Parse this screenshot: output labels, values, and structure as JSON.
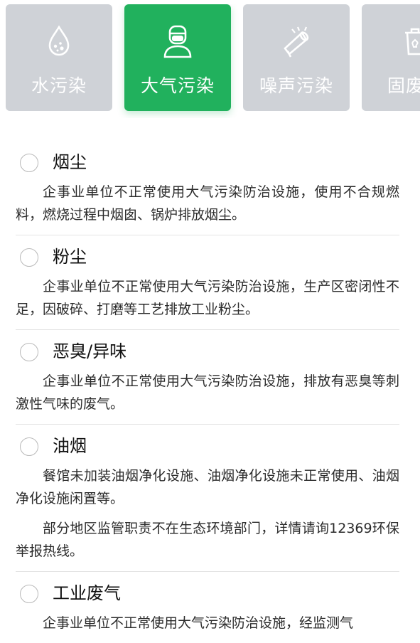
{
  "tabs": [
    {
      "label": "水污染",
      "icon": "water-drop-icon",
      "active": false
    },
    {
      "label": "大气污染",
      "icon": "masked-person-icon",
      "active": true
    },
    {
      "label": "噪声污染",
      "icon": "loudspeaker-icon",
      "active": false
    },
    {
      "label": "固废污",
      "icon": "trash-bin-icon",
      "active": false
    }
  ],
  "options": [
    {
      "title": "烟尘",
      "descriptions": [
        "企事业单位不正常使用大气污染防治设施，使用不合规燃料，燃烧过程中烟囱、锅炉排放烟尘。"
      ]
    },
    {
      "title": "粉尘",
      "descriptions": [
        "企事业单位不正常使用大气污染防治设施，生产区密闭性不足，因破碎、打磨等工艺排放工业粉尘。"
      ]
    },
    {
      "title": "恶臭/异味",
      "descriptions": [
        "企事业单位不正常使用大气污染防治设施，排放有恶臭等刺激性气味的废气。"
      ]
    },
    {
      "title": "油烟",
      "descriptions": [
        "餐馆未加装油烟净化设施、油烟净化设施未正常使用、油烟净化设施闲置等。",
        "部分地区监管职责不在生态环境部门，详情请询12369环保举报热线。"
      ]
    },
    {
      "title": "工业废气",
      "descriptions": [
        "企事业单位不正常使用大气污染防治设施，经监测气"
      ]
    }
  ],
  "colors": {
    "active_tab": "#21b15d",
    "inactive_tab": "#cfd2d7"
  }
}
